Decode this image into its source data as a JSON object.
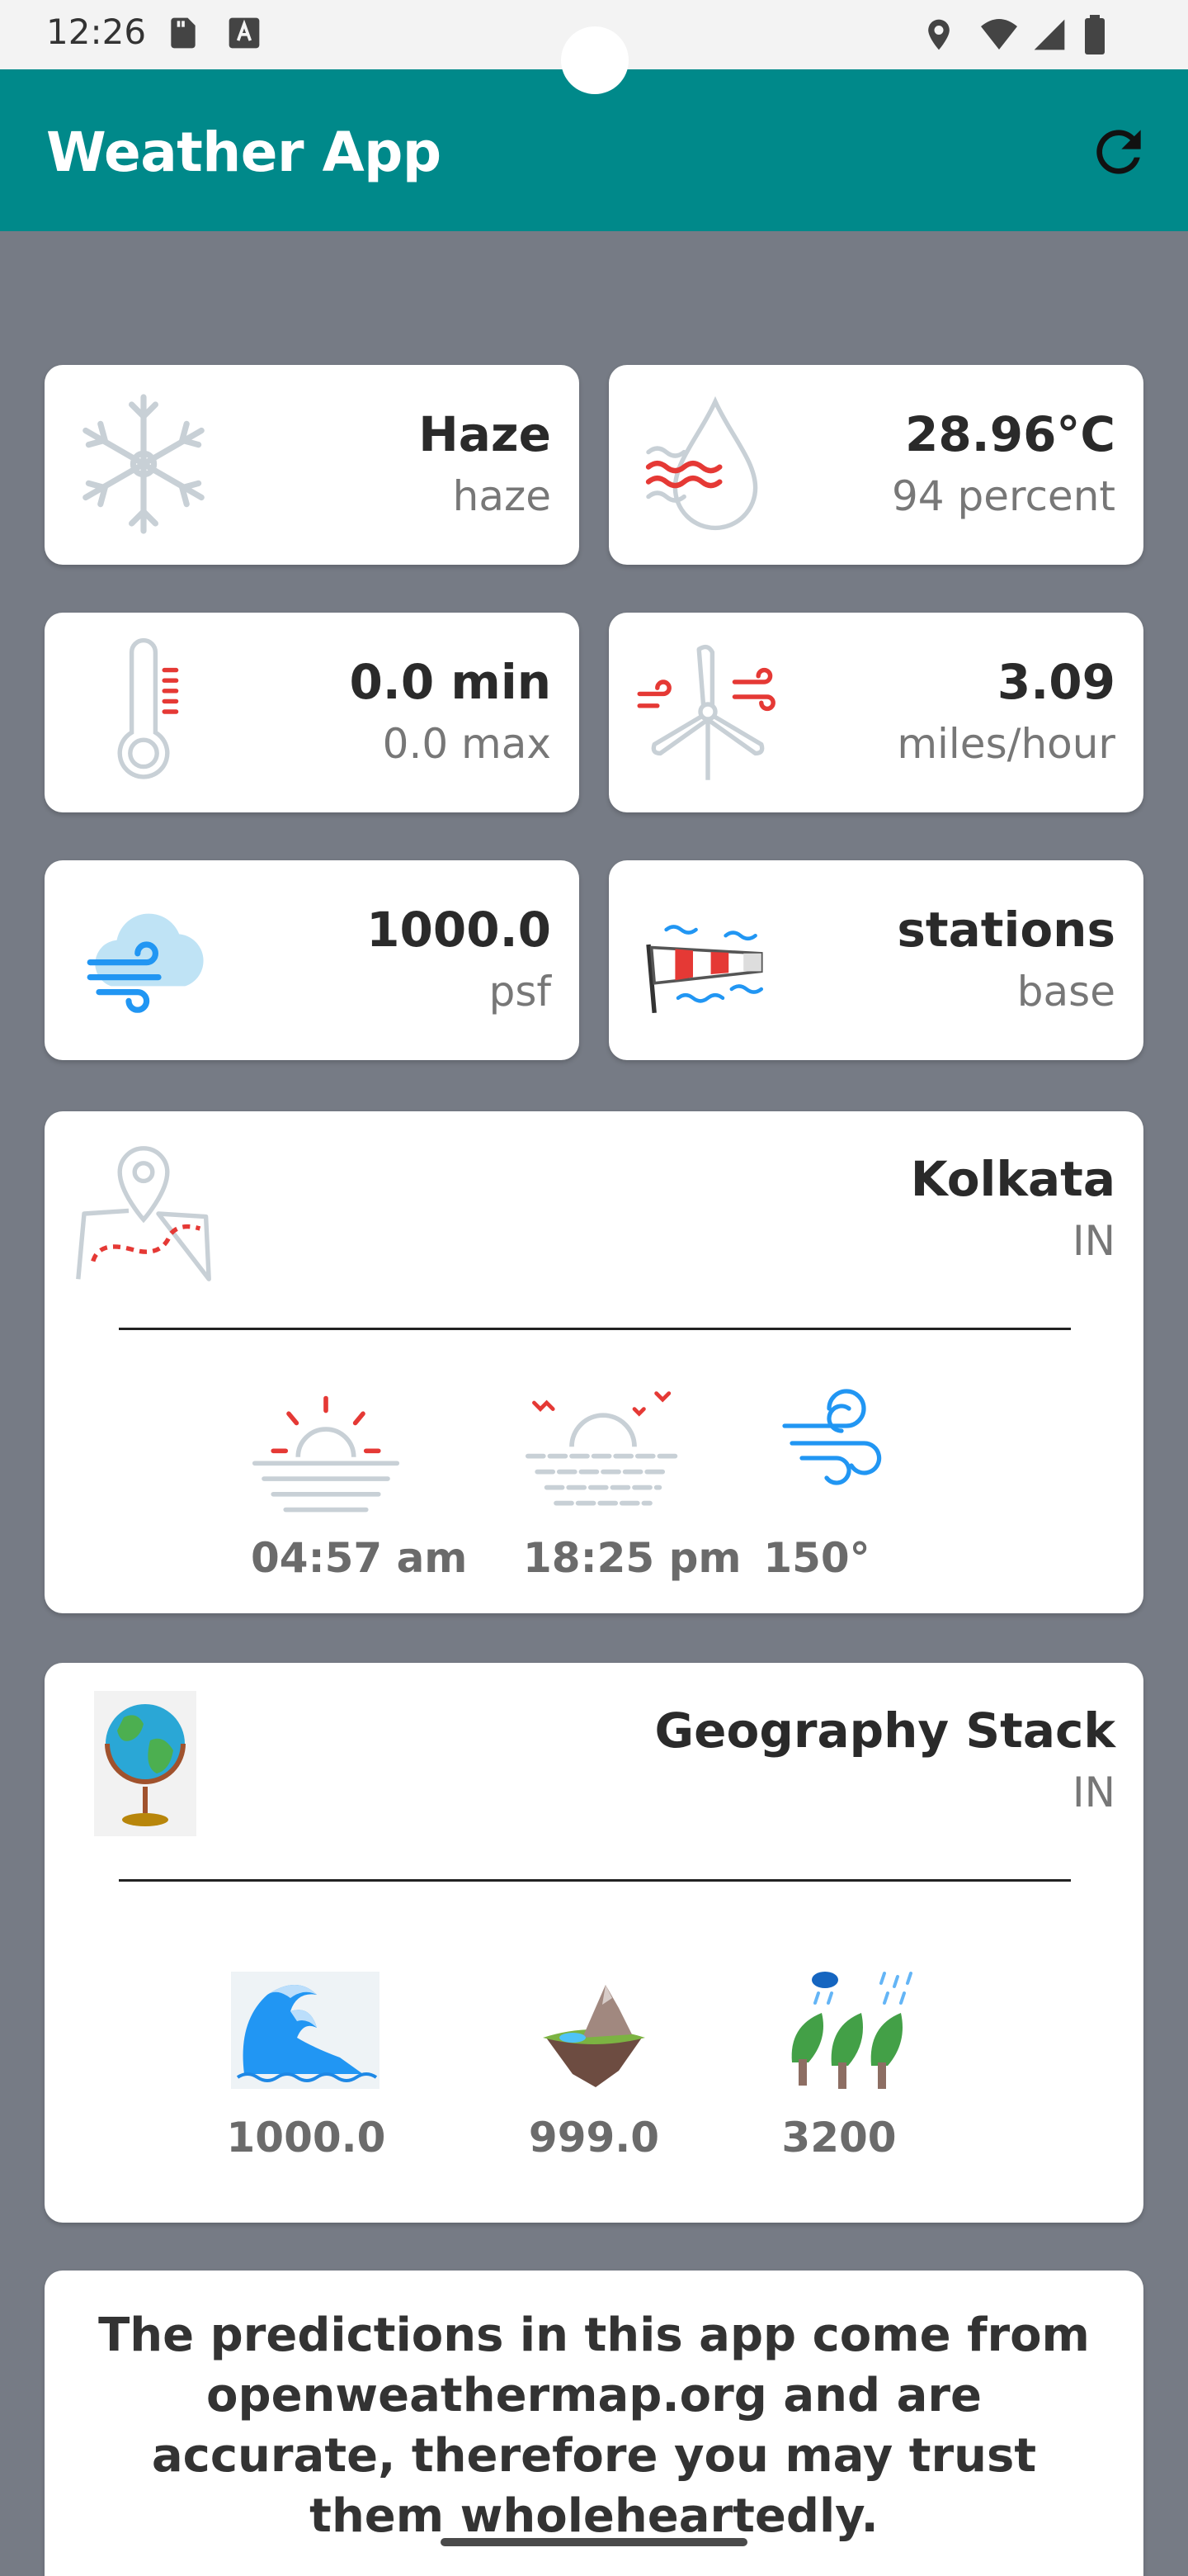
{
  "status_bar": {
    "time": "12:26"
  },
  "app_bar": {
    "title": "Weather App"
  },
  "tiles": {
    "condition": {
      "main": "Haze",
      "sub": "haze"
    },
    "humidity": {
      "main": "28.96°C",
      "sub": "94 percent"
    },
    "temperature": {
      "main": "0.0 min",
      "sub": "0.0 max"
    },
    "wind": {
      "main": "3.09",
      "sub": "miles/hour"
    },
    "pressure": {
      "main": "1000.0",
      "sub": "psf"
    },
    "source": {
      "main": "stations",
      "sub": "base"
    }
  },
  "location": {
    "city": "Kolkata",
    "country": "IN",
    "sunrise": "04:57 am",
    "sunset": "18:25 pm",
    "wind_degree": "150°"
  },
  "geography": {
    "title": "Geography Stack",
    "country": "IN",
    "sea_level": "1000.0",
    "ground_level": "999.0",
    "visibility": "3200"
  },
  "footer": {
    "disclaimer": "The predictions in this app come from openweathermap.org and are accurate, therefore you may trust them wholeheartedly."
  },
  "colors": {
    "app_bar": "#00898a",
    "background": "#767b85",
    "accent_red": "#e53935",
    "accent_blue": "#2196f3"
  }
}
